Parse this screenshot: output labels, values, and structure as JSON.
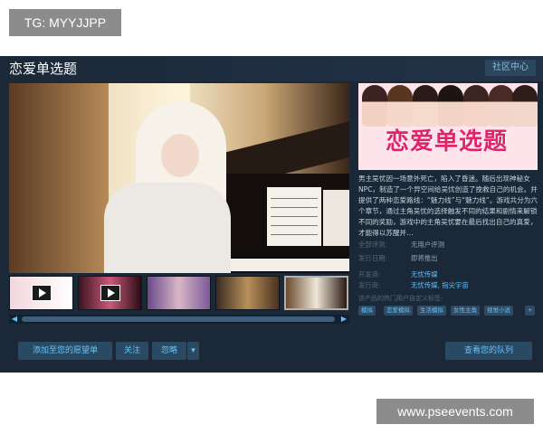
{
  "tg_label": "TG: MYYJJPP",
  "game": {
    "title": "恋爱单选题",
    "community_button": "社区中心"
  },
  "cover": {
    "title_text": "恋爱单选题"
  },
  "description": "男主吴忧因一场意外死亡，陷入了昏迷。随后出现神秘女NPC，制造了一个异空间给吴忧创造了挽救自己的机会。并提供了两种恋爱路线：“魅力线”与“魅力线”。游戏共分为六个章节，通过主角吴忧的选择触发不同的结果和剧情来解锁不同的奖励，游戏中的主角吴忧要在最后找出自己的真爱，才能得以苏醒并…",
  "info": [
    {
      "label": "全部评测:",
      "value": "无用户评测"
    },
    {
      "label": "发行日期:",
      "value": "即将推出"
    },
    {
      "label": "开发商:",
      "value": "无忧传媒"
    },
    {
      "label": "发行商:",
      "value": "无忧传媒, 指尖宇宙"
    }
  ],
  "tags_label": "该产品的热门用户自定义标签:",
  "tags": [
    "模拟",
    "恋爱模拟",
    "生活模拟",
    "女性主角",
    "视觉小说",
    "+"
  ],
  "actions": {
    "wishlist": "添加至您的愿望单",
    "follow": "关注",
    "ignore": "忽略",
    "ignore_dropdown": "▾",
    "queue": "查看您的队列"
  },
  "scroll": {
    "left": "◀",
    "right": "▶"
  },
  "watermark": "www.pseevents.com"
}
